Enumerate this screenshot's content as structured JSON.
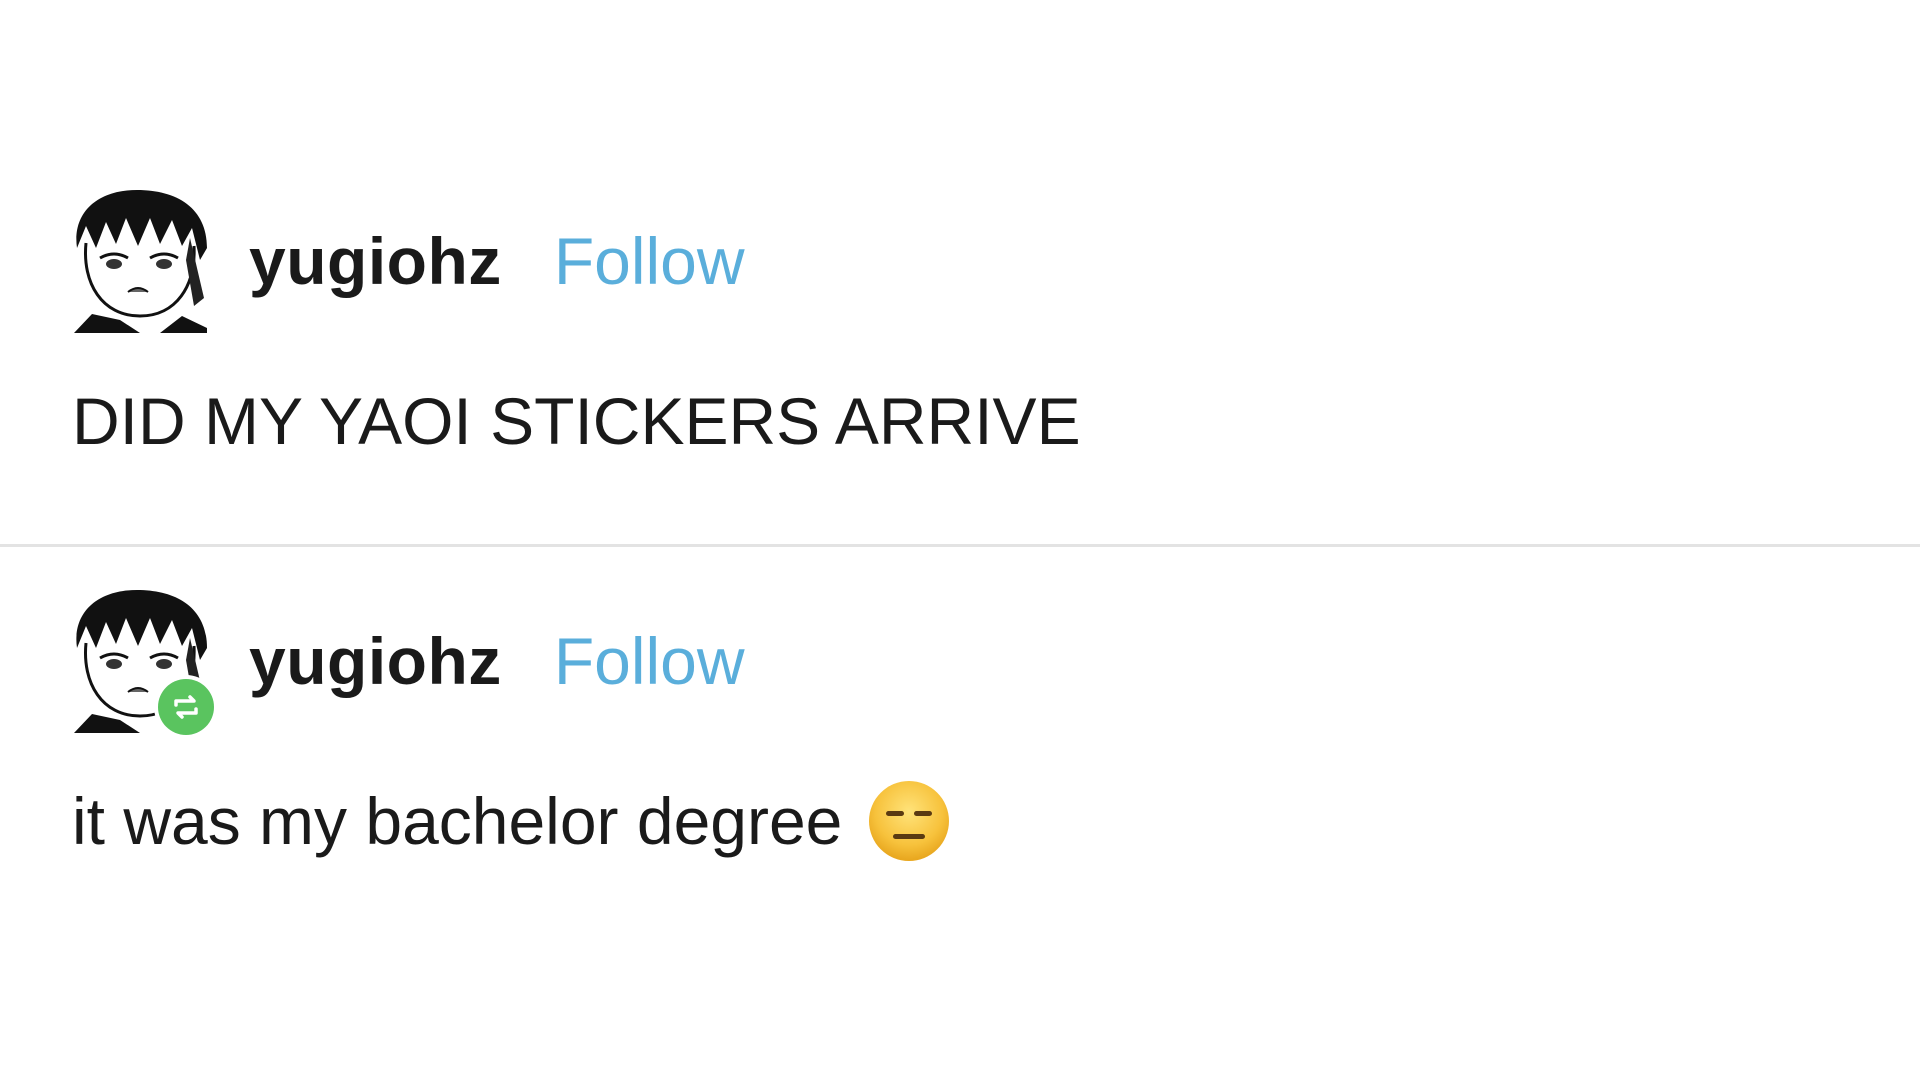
{
  "colors": {
    "follow_link": "#5aaedb",
    "reblog_badge": "#5ac45f",
    "divider": "#e3e3e3",
    "text": "#1a1a1a"
  },
  "posts": [
    {
      "avatar_icon": "anime-avatar-icon",
      "username": "yugiohz",
      "follow_label": "Follow",
      "body": "DID MY YAOI STICKERS ARRIVE",
      "reblogged": false
    },
    {
      "avatar_icon": "anime-avatar-icon",
      "badge_icon": "reblog-icon",
      "username": "yugiohz",
      "follow_label": "Follow",
      "body": "it was my bachelor degree",
      "emoji_icon": "expressionless-face-emoji-icon",
      "reblogged": true
    }
  ]
}
